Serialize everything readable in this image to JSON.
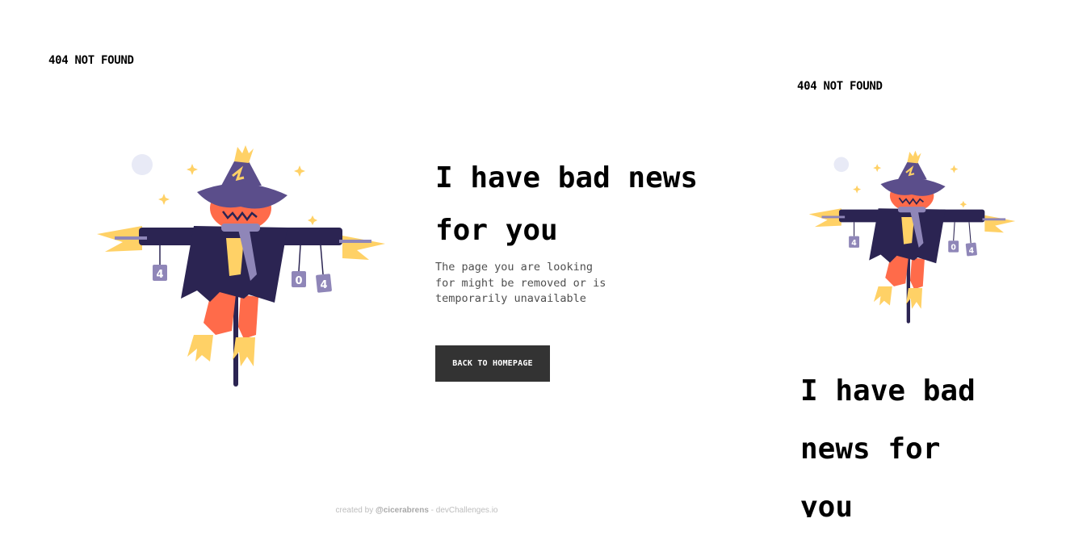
{
  "brand": {
    "label": "404 NOT FOUND"
  },
  "main": {
    "headline": [
      "I have bad news",
      "for you"
    ],
    "description": [
      "The page you are looking",
      "for might be removed or is",
      "temporarily unavailable"
    ],
    "button_label": "BACK TO HOMEPAGE"
  },
  "illustration": {
    "cans": [
      "4",
      "0",
      "4"
    ]
  },
  "mobile": {
    "brand": "404 NOT FOUND",
    "headline": [
      "I have bad",
      "news for",
      "you"
    ]
  },
  "footer": {
    "prefix": "created by ",
    "author": "@cicerabrens",
    "suffix": " - devChallenges.io"
  },
  "colors": {
    "button": "#333333",
    "hat": "#5b4e8b",
    "coat": "#2b2452",
    "face": "#ff6b4a",
    "straw": "#ffd166",
    "scarf": "#8f86b8",
    "moon": "#e8eaf6"
  }
}
